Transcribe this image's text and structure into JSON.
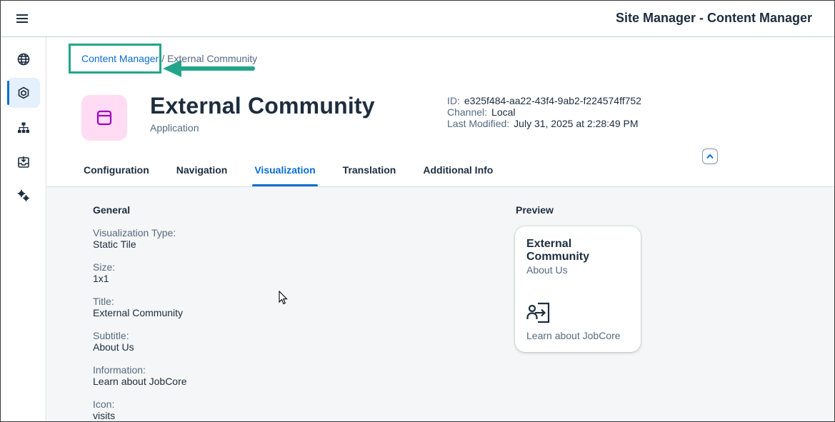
{
  "shell": {
    "title": "Site Manager - Content Manager",
    "menu_icon": "hamburger-icon"
  },
  "sidenav": {
    "items": [
      {
        "name": "globe-icon",
        "active": false
      },
      {
        "name": "content-package-icon",
        "active": true
      },
      {
        "name": "hierarchy-icon",
        "active": false
      },
      {
        "name": "inbox-download-icon",
        "active": false
      },
      {
        "name": "settings-gears-icon",
        "active": false
      }
    ]
  },
  "breadcrumb": {
    "link": "Content Manager",
    "separator": "/",
    "current": "External Community"
  },
  "object": {
    "title": "External Community",
    "subtitle": "Application",
    "icon": "application-window-icon",
    "attributes": [
      {
        "label": "ID:",
        "value": "e325f484-aa22-43f4-9ab2-f224574ff752"
      },
      {
        "label": "Channel:",
        "value": "Local"
      },
      {
        "label": "Last Modified:",
        "value": "July 31, 2025 at 2:28:49 PM"
      }
    ]
  },
  "tabs": [
    "Configuration",
    "Navigation",
    "Visualization",
    "Translation",
    "Additional Info"
  ],
  "active_tab": "Visualization",
  "general": {
    "title": "General",
    "fields": [
      {
        "label": "Visualization Type:",
        "value": "Static Tile"
      },
      {
        "label": "Size:",
        "value": "1x1"
      },
      {
        "label": "Title:",
        "value": "External Community"
      },
      {
        "label": "Subtitle:",
        "value": "About Us"
      },
      {
        "label": "Information:",
        "value": "Learn about JobCore"
      },
      {
        "label": "Icon:",
        "value": "visits"
      }
    ]
  },
  "preview": {
    "title": "Preview",
    "tile": {
      "title": "External Community",
      "subtitle": "About Us",
      "icon": "visits-icon",
      "info": "Learn about JobCore"
    }
  },
  "colors": {
    "accent": "#0a6ed1",
    "highlight": "#22a58a",
    "app_icon_bg": "#ffdcf3",
    "app_icon_fg": "#a100c2"
  }
}
